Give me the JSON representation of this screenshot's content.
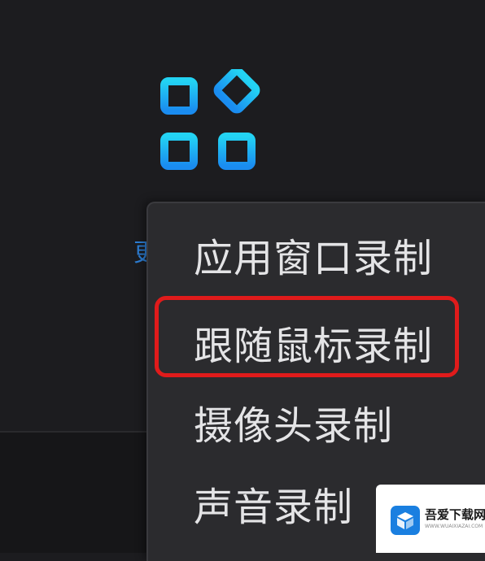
{
  "colors": {
    "background": "#1c1c1f",
    "menu_background": "#2b2b2e",
    "menu_text": "#e4e4e6",
    "icon_gradient_top": "#23d3f3",
    "icon_gradient_bottom": "#1a8cf0",
    "highlight_border": "#e01b1b",
    "partial_label": "#2d7fd6"
  },
  "app_icon": {
    "icon": "apps-grid-icon"
  },
  "partial_label": {
    "text": "更"
  },
  "context_menu": {
    "items": [
      {
        "label": "应用窗口录制",
        "highlighted": false
      },
      {
        "label": "跟随鼠标录制",
        "highlighted": true
      },
      {
        "label": "摄像头录制",
        "highlighted": false
      },
      {
        "label": "声音录制",
        "highlighted": false
      }
    ]
  },
  "watermark": {
    "title": "吾爱下载网",
    "subtitle": "WWW.WUAIXIAZAI.COM",
    "icon": "box-logo-icon"
  }
}
